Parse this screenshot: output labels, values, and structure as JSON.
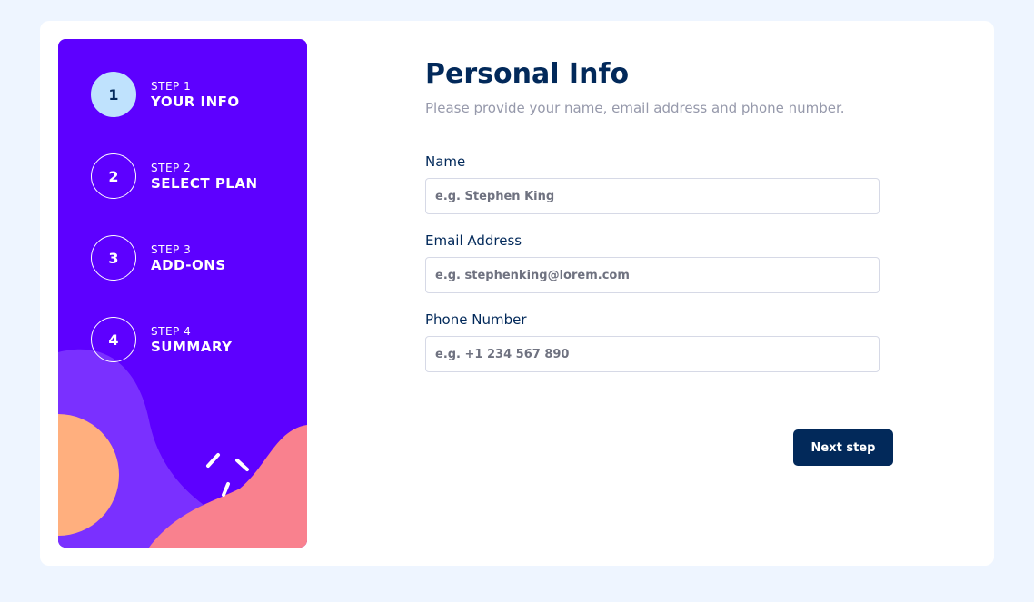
{
  "sidebar": {
    "steps": [
      {
        "number": "1",
        "kicker": "STEP 1",
        "title": "YOUR INFO",
        "active": true
      },
      {
        "number": "2",
        "kicker": "STEP 2",
        "title": "SELECT PLAN",
        "active": false
      },
      {
        "number": "3",
        "kicker": "STEP 3",
        "title": "ADD-ONS",
        "active": false
      },
      {
        "number": "4",
        "kicker": "STEP 4",
        "title": "SUMMARY",
        "active": false
      }
    ]
  },
  "main": {
    "title": "Personal Info",
    "subtitle": "Please provide your name, email address and phone number.",
    "fields": [
      {
        "label": "Name",
        "placeholder": "e.g. Stephen King",
        "value": ""
      },
      {
        "label": "Email Address",
        "placeholder": "e.g. stephenking@lorem.com",
        "value": ""
      },
      {
        "label": "Phone Number",
        "placeholder": "e.g. +1 234 567 890",
        "value": ""
      }
    ],
    "next_label": "Next step"
  },
  "colors": {
    "sidebar_bg": "#5d00ff",
    "active_step_bg": "#bfe2fd",
    "title": "#02295a",
    "subtitle": "#9699ab",
    "button_bg": "#02295a",
    "decor_orange": "#ffaf7e",
    "decor_pink": "#f9818e",
    "decor_purple": "#7a30ff"
  }
}
